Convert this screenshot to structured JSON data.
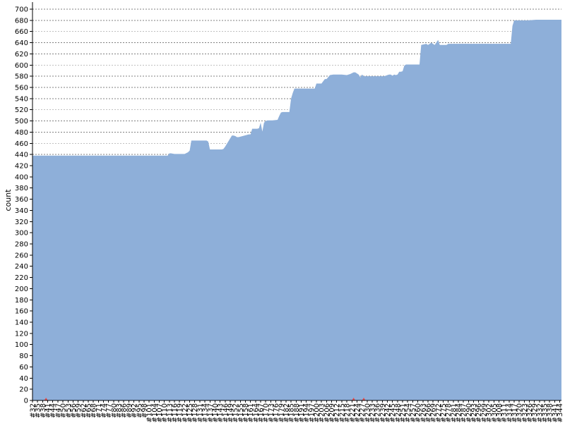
{
  "chart_data": {
    "type": "area",
    "ylabel": "count",
    "ylim": [
      0,
      700
    ],
    "yticks": [
      0,
      20,
      40,
      60,
      80,
      100,
      120,
      140,
      160,
      180,
      200,
      220,
      240,
      260,
      280,
      300,
      320,
      340,
      360,
      380,
      400,
      420,
      440,
      460,
      480,
      500,
      520,
      540,
      560,
      580,
      600,
      620,
      640,
      660,
      680,
      700
    ],
    "grid": true,
    "fill_color": "#8eafd9",
    "grid_color": "#808080",
    "marker_color": "#e05050",
    "x_ticks": [
      "#32",
      "#35",
      "#38",
      "#41",
      "#44",
      "#47",
      "#50",
      "#53",
      "#56",
      "#59",
      "#62",
      "#65",
      "#68",
      "#71",
      "#74",
      "#77",
      "#80",
      "#83",
      "#86",
      "#89",
      "#92",
      "#95",
      "#98",
      "#101",
      "#104",
      "#107",
      "#110",
      "#113",
      "#116",
      "#119",
      "#122",
      "#125",
      "#128",
      "#131",
      "#134",
      "#137",
      "#140",
      "#143",
      "#146",
      "#149",
      "#152",
      "#155",
      "#158",
      "#161",
      "#164",
      "#167",
      "#170",
      "#173",
      "#176",
      "#179",
      "#182",
      "#185",
      "#188",
      "#191",
      "#194",
      "#197",
      "#200",
      "#203",
      "#206",
      "#209",
      "#212",
      "#215",
      "#218",
      "#221",
      "#224",
      "#227",
      "#230",
      "#233",
      "#236",
      "#239",
      "#242",
      "#245",
      "#248",
      "#251",
      "#254",
      "#257",
      "#260",
      "#263",
      "#266",
      "#269",
      "#272",
      "#275",
      "#278",
      "#281",
      "#284",
      "#287",
      "#290",
      "#293",
      "#296",
      "#299",
      "#302",
      "#305",
      "#308",
      "#311",
      "#314",
      "#317",
      "#320",
      "#323",
      "#326",
      "#329",
      "#332",
      "#335",
      "#338",
      "#341",
      "#344"
    ],
    "x_range": [
      32,
      345
    ],
    "series": [
      {
        "x": [
          32,
          112,
          113,
          114,
          116,
          122,
          124,
          125,
          126,
          130,
          134,
          135,
          136,
          137,
          143,
          144,
          145,
          146,
          150,
          151,
          152,
          153,
          154,
          160,
          161,
          162,
          163,
          164,
          165,
          166,
          167,
          168,
          169,
          170,
          171,
          172,
          173,
          174,
          177,
          178,
          179,
          180,
          184,
          185,
          186,
          187,
          188,
          189,
          190,
          199,
          200,
          201,
          202,
          203,
          204,
          205,
          206,
          208,
          210,
          212,
          215,
          218,
          220,
          222,
          223,
          225,
          226,
          227,
          228,
          229,
          230,
          232,
          234,
          240,
          241,
          242,
          243,
          244,
          245,
          246,
          247,
          248,
          249,
          250,
          251,
          252,
          253,
          254,
          255,
          256,
          257,
          258,
          259,
          260,
          261,
          262,
          265,
          266,
          268,
          270,
          272,
          273,
          274,
          275,
          276,
          277,
          278,
          279,
          280,
          282,
          284,
          286,
          290,
          300,
          310,
          315,
          316,
          317,
          318,
          320,
          325,
          330,
          335,
          340,
          345
        ],
        "values": [
          438,
          438,
          442,
          442,
          441,
          441,
          444,
          447,
          465,
          465,
          465,
          465,
          463,
          449,
          449,
          449,
          450,
          454,
          474,
          474,
          473,
          471,
          471,
          476,
          476,
          486,
          486,
          486,
          486,
          487,
          497,
          481,
          497,
          500,
          501,
          501,
          501,
          501,
          502,
          509,
          515,
          516,
          516,
          540,
          550,
          558,
          558,
          558,
          558,
          558,
          567,
          567,
          567,
          567,
          571,
          575,
          575,
          582,
          583,
          583,
          583,
          582,
          584,
          587,
          587,
          583,
          578,
          583,
          580,
          580,
          580,
          580,
          580,
          580,
          581,
          582,
          583,
          583,
          581,
          583,
          582,
          583,
          588,
          588,
          589,
          599,
          601,
          601,
          601,
          601,
          601,
          601,
          601,
          601,
          601,
          636,
          638,
          636,
          640,
          636,
          645,
          636,
          636,
          636,
          636,
          636,
          638,
          638,
          638,
          638,
          638,
          638,
          638,
          638,
          638,
          638,
          670,
          680,
          680,
          680,
          680,
          681,
          681,
          681,
          681
        ]
      }
    ],
    "markers": [
      {
        "x": 40,
        "y": 0
      },
      {
        "x": 222,
        "y": 0
      },
      {
        "x": 228,
        "y": 0
      }
    ]
  }
}
